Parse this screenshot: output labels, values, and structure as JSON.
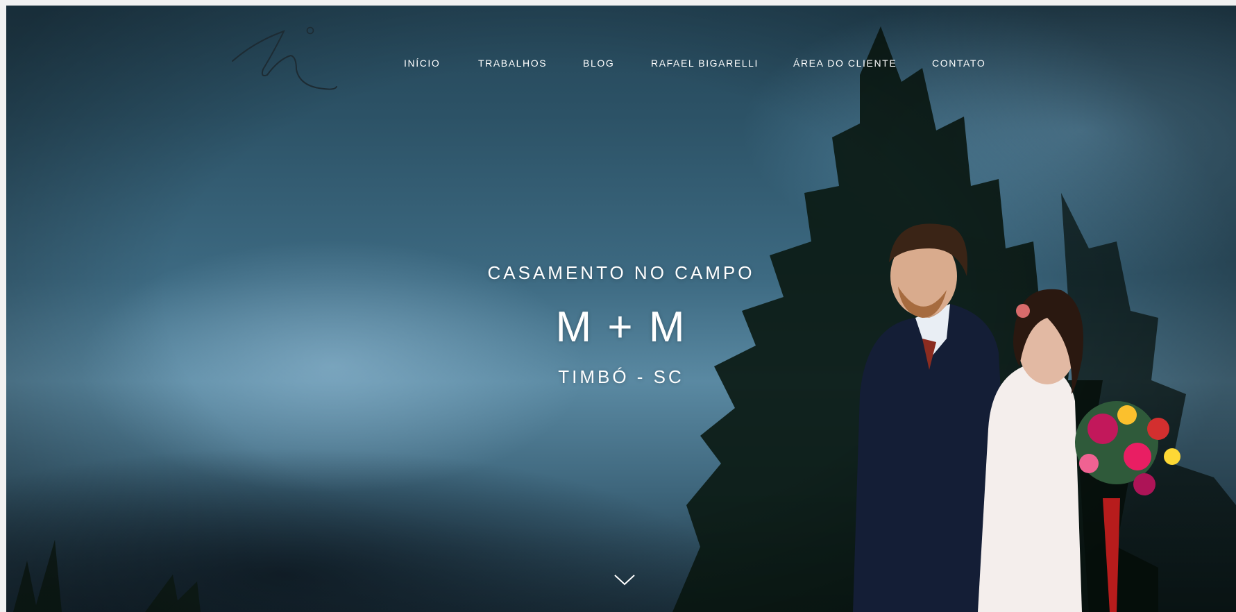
{
  "nav": {
    "items": [
      {
        "label": "INÍCIO"
      },
      {
        "label": "TRABALHOS"
      },
      {
        "label": "BLOG"
      },
      {
        "label": "RAFAEL BIGARELLI"
      },
      {
        "label": "ÁREA DO CLIENTE"
      },
      {
        "label": "CONTATO"
      }
    ]
  },
  "hero": {
    "subtitle": "CASAMENTO NO CAMPO",
    "title": "M + M",
    "location": "TIMBÓ - SC"
  },
  "icons": {
    "logo": "signature-logo",
    "scroll": "chevron-down-icon"
  },
  "colors": {
    "text": "#ffffff",
    "sky_dark": "#254658",
    "sky_light": "#5a89a2"
  }
}
